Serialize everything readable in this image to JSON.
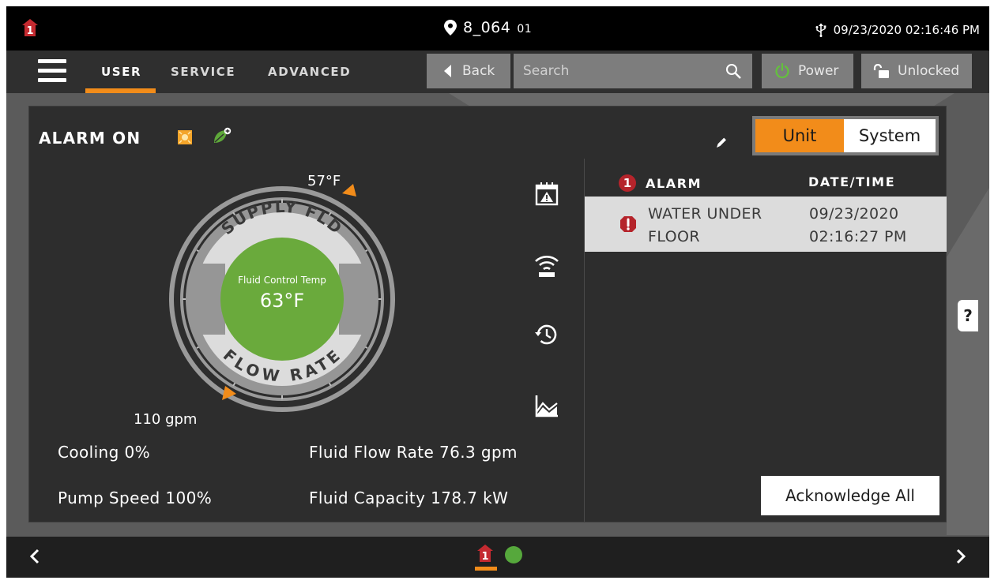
{
  "status_bar": {
    "unit_id": "8_064",
    "unit_number": "01",
    "datetime": "09/23/2020 02:16:46 PM"
  },
  "nav": {
    "tabs": [
      {
        "label": "USER",
        "active": true
      },
      {
        "label": "SERVICE",
        "active": false
      },
      {
        "label": "ADVANCED",
        "active": false
      }
    ],
    "back_label": "Back",
    "search_placeholder": "Search",
    "power_label": "Power",
    "lock_label": "Unlocked"
  },
  "panel": {
    "title": "ALARM ON",
    "toggle": {
      "unit": "Unit",
      "system": "System",
      "selected": "Unit"
    },
    "gauge": {
      "top_label": "57°F",
      "bottom_label": "110 gpm",
      "outer_top_text": "SUPPLY FLD",
      "outer_bottom_text": "FLOW RATE",
      "center_caption": "Fluid Control Temp",
      "center_value": "63°F"
    },
    "side_icons": [
      "calendar-alert-icon",
      "wifi-signal-icon",
      "history-icon",
      "trend-chart-icon"
    ],
    "metrics": {
      "cooling": "Cooling 0%",
      "pump_speed": "Pump Speed 100%",
      "fluid_flow_rate": "Fluid Flow Rate 76.3 gpm",
      "fluid_capacity": "Fluid Capacity 178.7 kW"
    },
    "alarms": {
      "count": "1",
      "header_alarm": "ALARM",
      "header_datetime": "DATE/TIME",
      "rows": [
        {
          "name_line1": "WATER UNDER",
          "name_line2": "FLOOR",
          "date": "09/23/2020",
          "time": "02:16:27 PM"
        }
      ]
    },
    "acknowledge_label": "Acknowledge All",
    "help_label": "?"
  },
  "colors": {
    "accent_orange": "#f28c1a",
    "alarm_red": "#b5242b",
    "ok_green": "#56a83c",
    "gauge_green": "#6aaa3c"
  }
}
